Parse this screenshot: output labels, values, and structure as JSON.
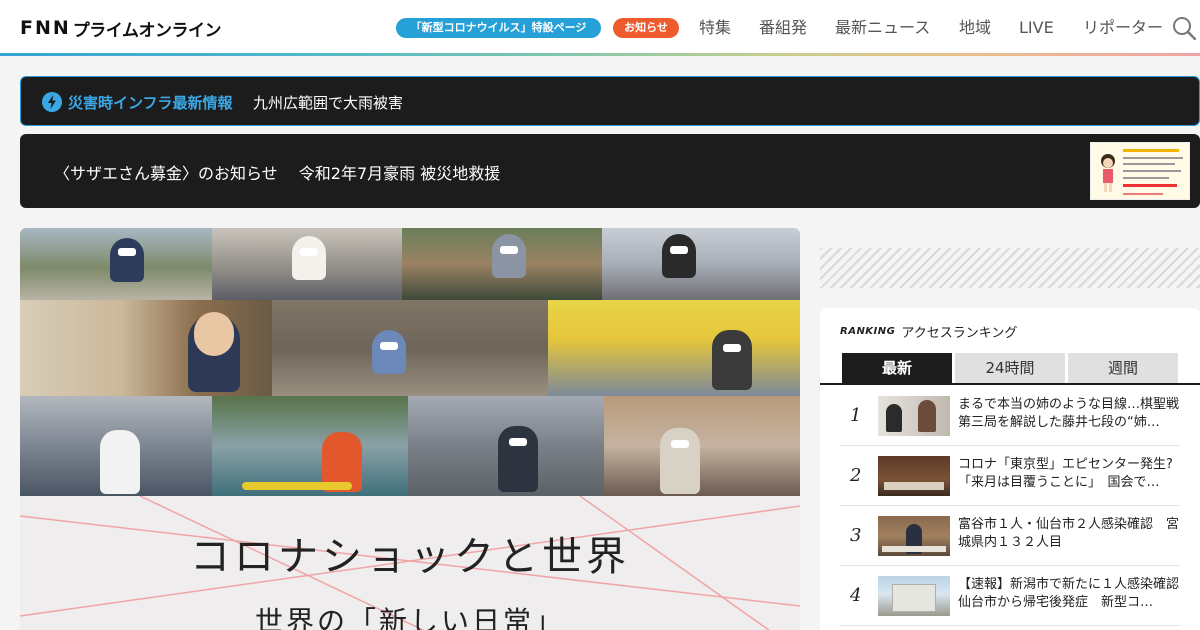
{
  "header": {
    "logo_fnn": "FNN",
    "logo_prime": "プライムオンライン",
    "corona_pill": "「新型コロナウイルス」特設ページ",
    "news_pill": "お知らせ",
    "nav": [
      "特集",
      "番組発",
      "最新ニュース",
      "地域",
      "LIVE",
      "リポーター"
    ]
  },
  "disaster": {
    "label": "災害時インフラ最新情報",
    "text": "九州広範囲で大雨被害"
  },
  "sazae": {
    "text": "〈サザエさん募金〉のお知らせ　 令和2年7月豪雨 被災地救援"
  },
  "hero": {
    "title": "コロナショックと世界",
    "subtitle": "世界の「新しい日常」"
  },
  "ranking": {
    "logo": "RANKING",
    "title": "アクセスランキング",
    "tabs": [
      "最新",
      "24時間",
      "週間"
    ],
    "items": [
      {
        "rank": "1",
        "title": "まるで本当の姉のような目線…棋聖戦第三局を解説した藤井七段の“姉…"
      },
      {
        "rank": "2",
        "title": "コロナ「東京型」エピセンター発生?「来月は目覆うことに」　国会で…"
      },
      {
        "rank": "3",
        "title": "富谷市１人・仙台市２人感染確認　宮城県内１３２人目"
      },
      {
        "rank": "4",
        "title": "【速報】新潟市で新たに１人感染確認　仙台市から帰宅後発症　新型コ…"
      }
    ]
  },
  "colors": {
    "accent_blue": "#26a1d8",
    "news_orange": "#ef5b2e",
    "dark_bar": "#1c1c1c"
  }
}
